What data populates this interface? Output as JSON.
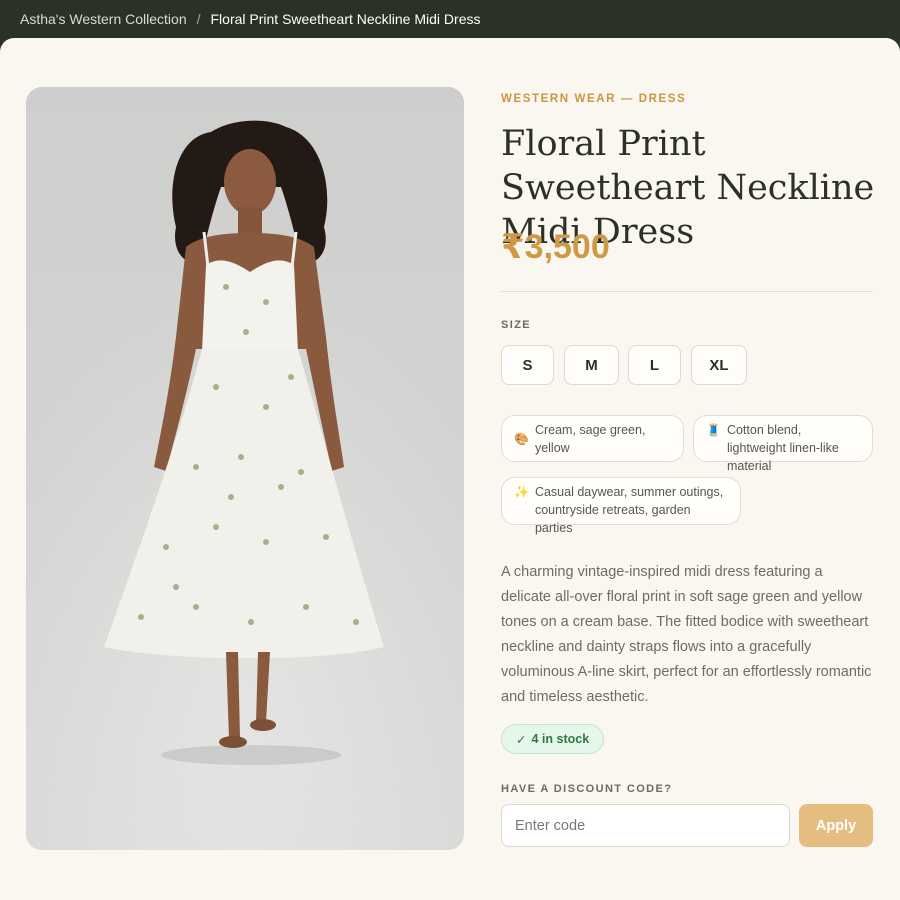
{
  "breadcrumb": {
    "store": "Astha's Western Collection",
    "separator": "/",
    "current": "Floral Print Sweetheart Neckline Midi Dress"
  },
  "product": {
    "category": "WESTERN WEAR — DRESS",
    "title": "Floral Print Sweetheart Neckline Midi Dress",
    "price": "₹3,500",
    "image_description": "Model wearing a cream midi dress with sage green floral print"
  },
  "size": {
    "label": "SIZE",
    "options": [
      "S",
      "M",
      "L",
      "XL"
    ]
  },
  "attributes": [
    {
      "icon": "palette-icon",
      "glyph": "🎨",
      "text": "Cream, sage green, yellow"
    },
    {
      "icon": "thread-icon",
      "glyph": "🧵",
      "line1": "Cotton blend,",
      "line2": "lightweight linen-like material"
    },
    {
      "icon": "sparkles-icon",
      "glyph": "✨",
      "line1": "Casual daywear, summer outings,",
      "line2": "countryside retreats, garden parties"
    }
  ],
  "description": "A charming vintage-inspired midi dress featuring a delicate all-over floral print in soft sage green and yellow tones on a cream base. The fitted bodice with sweetheart neckline and dainty straps flows into a gracefully voluminous A-line skirt, perfect for an effortlessly romantic and timeless aesthetic.",
  "stock": {
    "check": "✓",
    "text": "4 in stock"
  },
  "discount": {
    "label": "HAVE A DISCOUNT CODE?",
    "placeholder": "Enter code",
    "value": "",
    "apply_label": "Apply"
  },
  "colors": {
    "accent": "#cf9a46",
    "header_bg": "#2b3125",
    "page_bg": "#faf6f0",
    "stock_green": "#2e7a45",
    "apply_bg": "#e6bd80"
  }
}
